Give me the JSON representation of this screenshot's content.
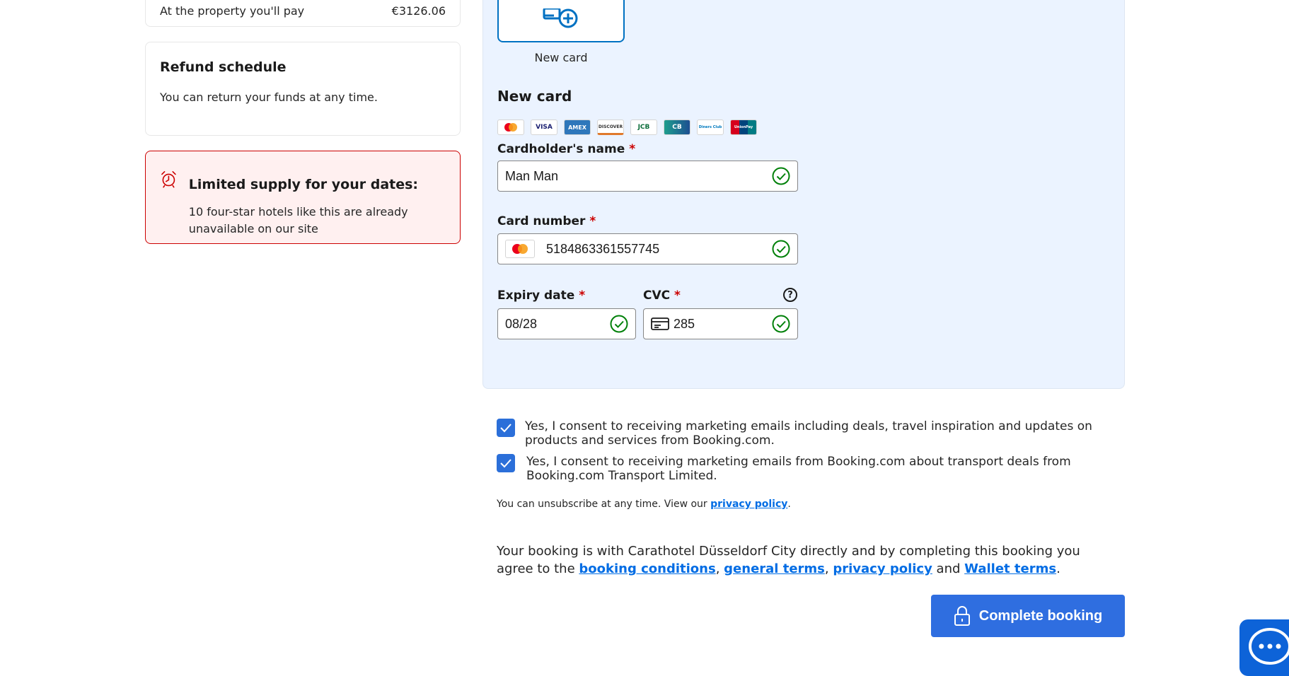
{
  "summary": {
    "pay_label": "At the property you'll pay",
    "pay_amount": "€3126.06"
  },
  "refund": {
    "title": "Refund schedule",
    "text": "You can return your funds at any time."
  },
  "limited": {
    "title": "Limited supply for your dates:",
    "text": "10 four-star hotels like this are already unavailable on our site"
  },
  "payment": {
    "tile_label": "New card",
    "section_title": "New card",
    "card_logos": [
      "mastercard",
      "VISA",
      "AMEX",
      "DISCOVER",
      "JCB",
      "CB",
      "Diners Club",
      "UnionPay"
    ],
    "cardholder_label": "Cardholder's name",
    "cardholder_value": "Man Man",
    "number_label": "Card number",
    "number_value": "5184863361557745",
    "expiry_label": "Expiry date",
    "expiry_value": "08/28",
    "cvc_label": "CVC",
    "cvc_value": "285",
    "required_mark": "*",
    "help_glyph": "?"
  },
  "consents": [
    {
      "text": "Yes, I consent to receiving marketing emails including deals, travel inspiration and updates on products and services from Booking.com.",
      "checked": true
    },
    {
      "text": "Yes, I consent to receiving marketing emails from Booking.com about transport deals from Booking.com Transport Limited.",
      "checked": true
    }
  ],
  "unsubscribe": {
    "text": "You can unsubscribe at any time. View our ",
    "link": "privacy policy",
    "end": "."
  },
  "terms": {
    "text": "Your booking is with Carathotel Düsseldorf City directly and by completing this booking you agree to the ",
    "link1": "booking conditions",
    "sep1": ", ",
    "link2": "general terms",
    "sep2": ", ",
    "link3": "privacy policy",
    "sep3": " and ",
    "link4": "Wallet terms",
    "end": "."
  },
  "complete_button": "Complete booking",
  "colors": {
    "primary": "#2f6ee0",
    "link": "#006ce4",
    "success": "#008009",
    "alert": "#cc0000",
    "panel": "#ebf3ff"
  }
}
